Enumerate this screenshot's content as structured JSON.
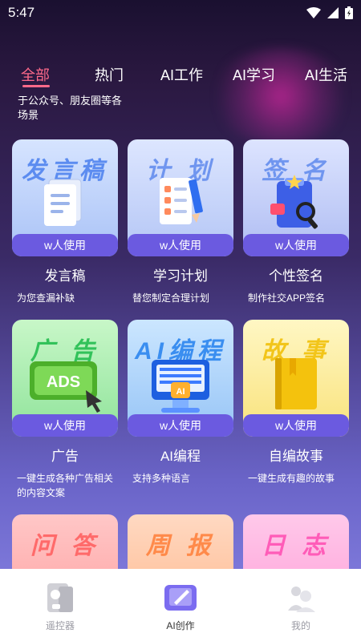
{
  "status": {
    "time": "5:47"
  },
  "tabs": [
    "全部",
    "热门",
    "AI工作",
    "AI学习",
    "AI生活"
  ],
  "category_desc": "于公众号、朋友圈等各场景",
  "cards": [
    {
      "thumb_title": "发言稿",
      "usage": "w人使用",
      "name": "发言稿",
      "desc": "为您查漏补缺"
    },
    {
      "thumb_title": "计 划",
      "usage": "w人使用",
      "name": "学习计划",
      "desc": "替您制定合理计划"
    },
    {
      "thumb_title": "签 名",
      "usage": "w人使用",
      "name": "个性签名",
      "desc": "制作社交APP签名"
    },
    {
      "thumb_title": "广 告",
      "usage": "w人使用",
      "name": "广告",
      "desc": "一键生成各种广告相关的内容文案",
      "art_text": "ADS"
    },
    {
      "thumb_title": "AI编程",
      "usage": "w人使用",
      "name": "AI编程",
      "desc": "支持多种语言",
      "art_text": "AI"
    },
    {
      "thumb_title": "故 事",
      "usage": "w人使用",
      "name": "自编故事",
      "desc": "一键生成有趣的故事"
    },
    {
      "thumb_title": "问 答"
    },
    {
      "thumb_title": "周 报"
    },
    {
      "thumb_title": "日 志"
    }
  ],
  "bottom_nav": [
    {
      "label": "遥控器",
      "icon": "remote-icon"
    },
    {
      "label": "AI创作",
      "icon": "ai-create-icon"
    },
    {
      "label": "我的",
      "icon": "profile-icon"
    }
  ]
}
